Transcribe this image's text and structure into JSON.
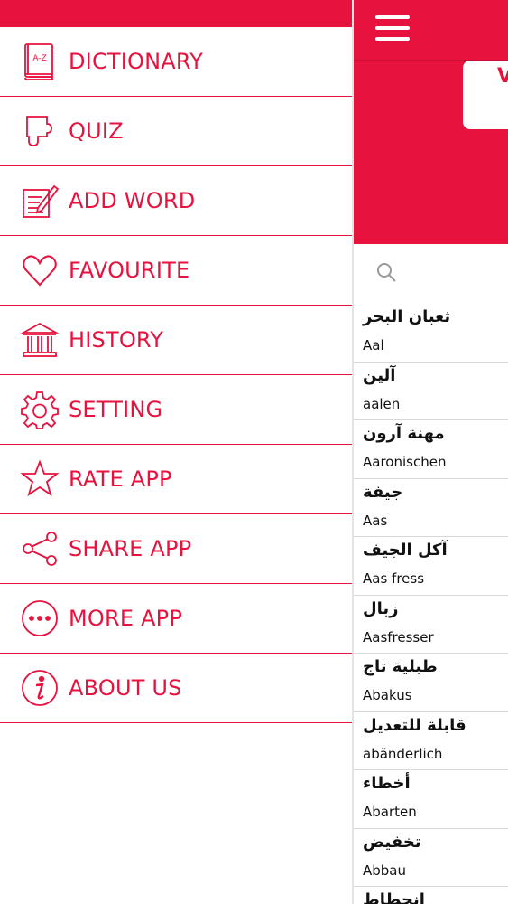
{
  "menu": {
    "items": [
      {
        "label": "DICTIONARY",
        "icon": "dictionary-book-icon"
      },
      {
        "label": "QUIZ",
        "icon": "puzzle-piece-icon"
      },
      {
        "label": "ADD WORD",
        "icon": "edit-note-icon"
      },
      {
        "label": "FAVOURITE",
        "icon": "heart-icon"
      },
      {
        "label": "HISTORY",
        "icon": "museum-icon"
      },
      {
        "label": "SETTING",
        "icon": "gear-icon"
      },
      {
        "label": "RATE APP",
        "icon": "star-icon"
      },
      {
        "label": "SHARE APP",
        "icon": "share-icon"
      },
      {
        "label": "MORE APP",
        "icon": "more-dots-icon"
      },
      {
        "label": "ABOUT US",
        "icon": "info-icon"
      }
    ],
    "book_icon_text": "A-Z"
  },
  "main": {
    "card_letter": "V",
    "search": {
      "placeholder": ""
    },
    "words": [
      {
        "ar": "ثعبان البحر",
        "de": "Aal"
      },
      {
        "ar": "آلين",
        "de": "aalen"
      },
      {
        "ar": "مهنة آرون",
        "de": "Aaronischen"
      },
      {
        "ar": "جيفة",
        "de": "Aas"
      },
      {
        "ar": "آكل الجيف",
        "de": "Aas fress"
      },
      {
        "ar": "زبال",
        "de": "Aasfresser"
      },
      {
        "ar": "طبلية تاج",
        "de": "Abakus"
      },
      {
        "ar": "قابلة للتعديل",
        "de": "abänderlich"
      },
      {
        "ar": "أخطاء",
        "de": "Abarten"
      },
      {
        "ar": "تخفيض",
        "de": "Abbau"
      },
      {
        "ar": "انحطاط",
        "de": ""
      }
    ]
  },
  "colors": {
    "accent": "#e8123e",
    "divider": "#d8d8d8"
  }
}
